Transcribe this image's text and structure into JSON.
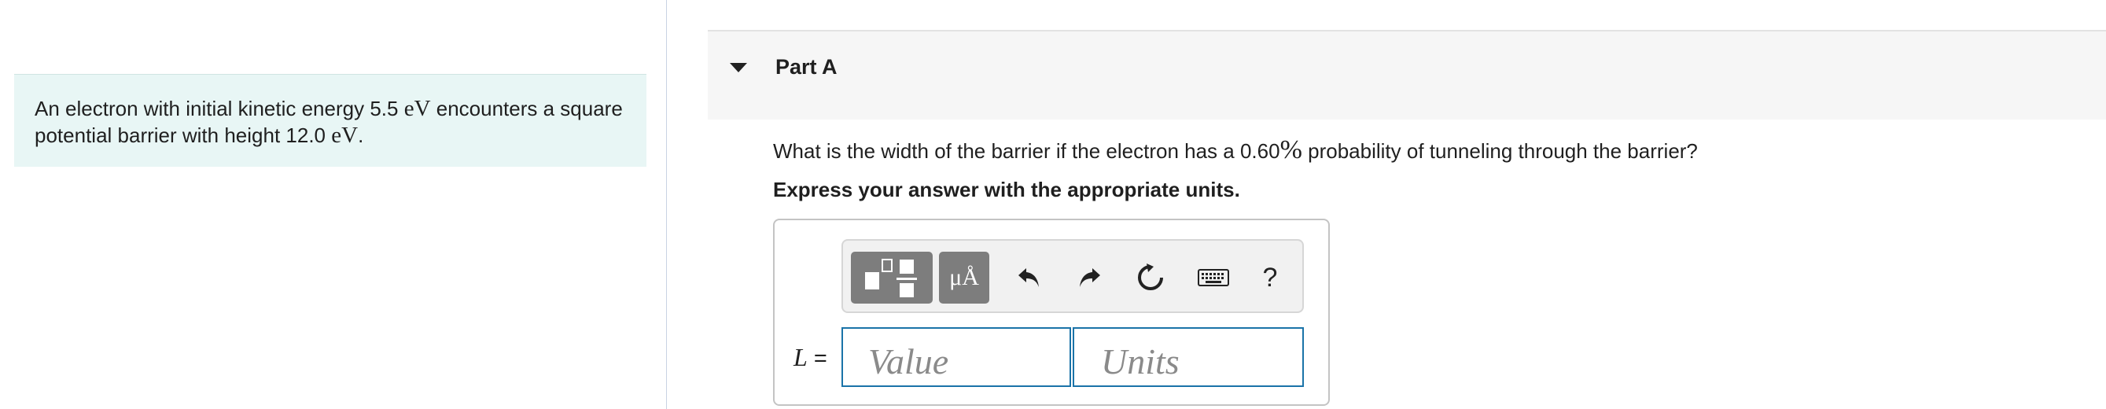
{
  "intro": {
    "text_before": "An electron with initial kinetic energy 5.5 ",
    "unit1": "eV",
    "text_middle": " encounters a square",
    "text_line2": "potential barrier with height 12.0 ",
    "unit2": "eV",
    "text_end": "."
  },
  "part": {
    "title": "Part A"
  },
  "question": {
    "text_before": "What is the width of the barrier if the electron has a 0.60",
    "percent": "%",
    "text_after": " probability of tunneling through the barrier?"
  },
  "instruction": "Express your answer with the appropriate units.",
  "toolbar": {
    "units_label": "μÅ",
    "help_label": "?"
  },
  "answer": {
    "variable": "L",
    "equals": " =",
    "value_placeholder": "Value",
    "units_placeholder": "Units"
  },
  "colors": {
    "intro_bg": "#e8f6f5",
    "toolbar_button": "#7d7d7d",
    "input_border": "#1a73a8"
  }
}
